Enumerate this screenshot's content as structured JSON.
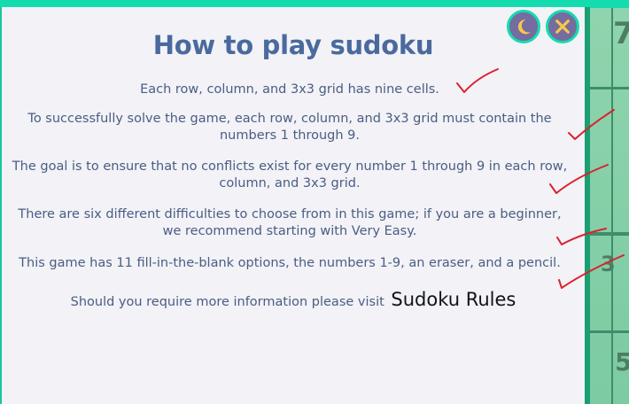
{
  "modal": {
    "title": "How to play sudoku",
    "rules": [
      "Each row, column, and 3x3 grid has nine cells.",
      "To successfully solve the game, each row, column, and 3x3 grid must contain the numbers 1 through 9.",
      "The goal is to ensure that no conflicts exist for every number 1 through 9 in each row, column, and 3x3 grid.",
      "There are six different difficulties to choose from in this game; if you are a beginner, we recommend starting with Very Easy.",
      "This game has 11 fill-in-the-blank options, the numbers 1-9, an eraser, and a pencil."
    ],
    "more_info_text": "Should you require more information please visit",
    "more_info_link": "Sudoku Rules"
  },
  "buttons": {
    "theme_icon": "moon-icon",
    "close_icon": "close-icon"
  },
  "background": {
    "visible_digits": [
      "7",
      "3",
      "5"
    ]
  },
  "colors": {
    "accent_teal": "#14dcae",
    "button_purple": "#756c9f",
    "icon_yellow": "#f6c84a",
    "title_blue": "#4a6a9e",
    "text_slate": "#4b5d83",
    "check_red": "#d9232e"
  }
}
